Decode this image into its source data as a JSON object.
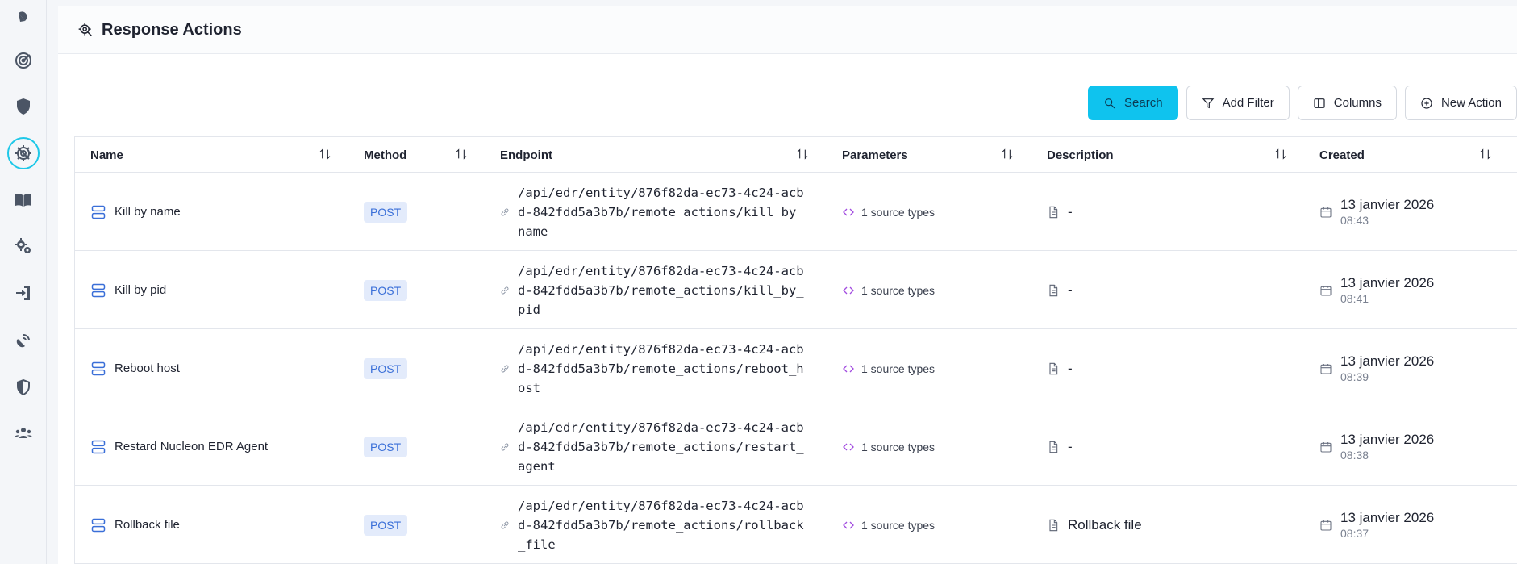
{
  "page": {
    "title": "Response Actions"
  },
  "sidebar": {
    "items": [
      {
        "icon": "satellite-dish-icon"
      },
      {
        "icon": "radar-icon"
      },
      {
        "icon": "shield-icon"
      },
      {
        "icon": "shield-gear-icon",
        "active": true
      },
      {
        "icon": "book-icon"
      },
      {
        "icon": "gears-icon"
      },
      {
        "icon": "sign-in-icon"
      },
      {
        "icon": "satellite-icon"
      },
      {
        "icon": "half-shield-icon"
      },
      {
        "icon": "users-gear-icon"
      }
    ]
  },
  "toolbar": {
    "search_label": "Search",
    "add_filter_label": "Add Filter",
    "columns_label": "Columns",
    "new_action_label": "New Action"
  },
  "table": {
    "columns": [
      "Name",
      "Method",
      "Endpoint",
      "Parameters",
      "Description",
      "Created"
    ],
    "rows": [
      {
        "name": "Kill by name",
        "method": "POST",
        "endpoint": "/api/edr/entity/876f82da-ec73-4c24-acbd-842fdd5a3b7b/remote_actions/kill_by_name",
        "parameters": "1 source types",
        "description": "-",
        "date": "13 janvier 2026",
        "time": "08:43"
      },
      {
        "name": "Kill by pid",
        "method": "POST",
        "endpoint": "/api/edr/entity/876f82da-ec73-4c24-acbd-842fdd5a3b7b/remote_actions/kill_by_pid",
        "parameters": "1 source types",
        "description": "-",
        "date": "13 janvier 2026",
        "time": "08:41"
      },
      {
        "name": "Reboot host",
        "method": "POST",
        "endpoint": "/api/edr/entity/876f82da-ec73-4c24-acbd-842fdd5a3b7b/remote_actions/reboot_host",
        "parameters": "1 source types",
        "description": "-",
        "date": "13 janvier 2026",
        "time": "08:39"
      },
      {
        "name": "Restard Nucleon EDR Agent",
        "method": "POST",
        "endpoint": "/api/edr/entity/876f82da-ec73-4c24-acbd-842fdd5a3b7b/remote_actions/restart_agent",
        "parameters": "1 source types",
        "description": "-",
        "date": "13 janvier 2026",
        "time": "08:38"
      },
      {
        "name": "Rollback file",
        "method": "POST",
        "endpoint": "/api/edr/entity/876f82da-ec73-4c24-acbd-842fdd5a3b7b/remote_actions/rollback_file",
        "parameters": "1 source types",
        "description": "Rollback file",
        "date": "13 janvier 2026",
        "time": "08:37"
      }
    ]
  },
  "colors": {
    "accent": "#0fc3ee",
    "method_badge_bg": "#e3ebfb",
    "method_badge_text": "#3a6fd8",
    "param_icon": "#a24ce0"
  }
}
